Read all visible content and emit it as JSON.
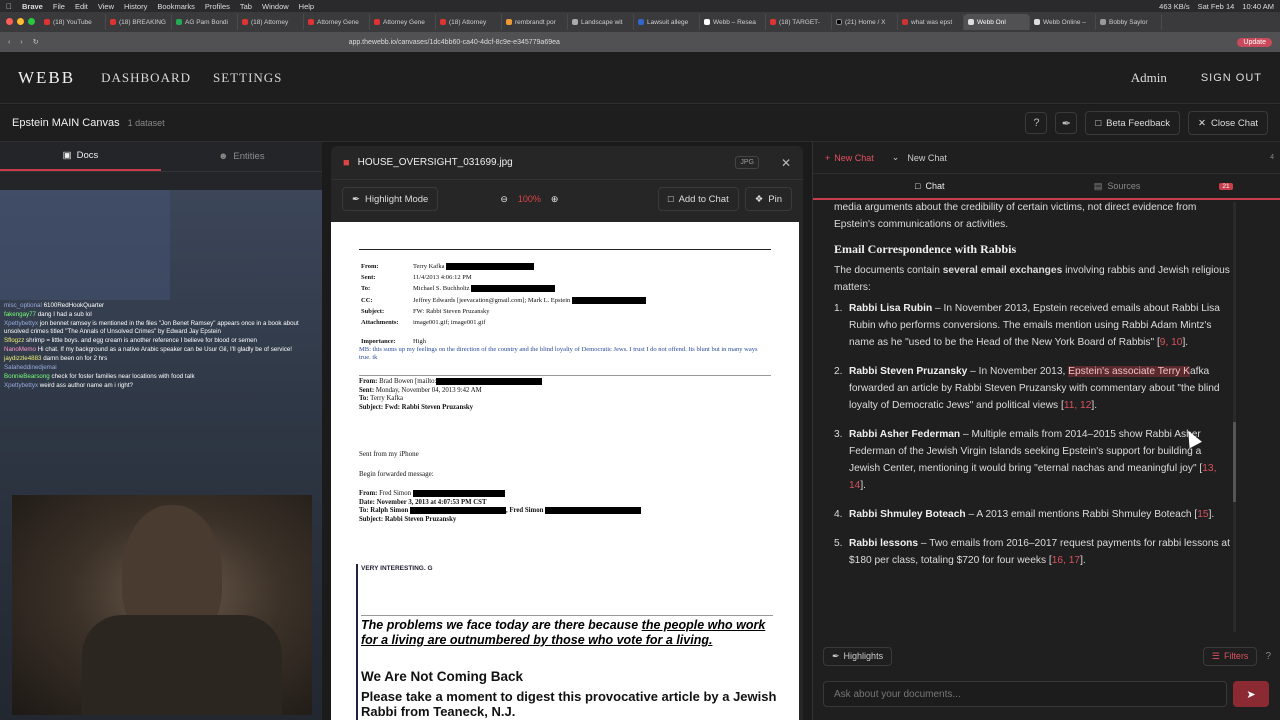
{
  "mac_menu": {
    "apple": "",
    "app": "Brave",
    "items": [
      "File",
      "Edit",
      "View",
      "History",
      "Bookmarks",
      "Profiles",
      "Tab",
      "Window",
      "Help"
    ],
    "status": [
      "463 KB/s",
      "Sat Feb 14",
      "10:40 AM"
    ]
  },
  "browser": {
    "tabs": [
      "(18) YouTube",
      "(18) BREAKING",
      "AG Pam Bondi",
      "(18) Attorney",
      "Attorney Gene",
      "Attorney Gene",
      "(18) Attorney",
      "rembrandt por",
      "Landscape wit",
      "Lawsuit allege",
      "Webb – Resea",
      "(18) TARGET-",
      "(21) Home / X",
      "what was epst",
      "Webb Onl",
      "Webb Online –",
      "Bobby Saylor"
    ],
    "active_tab_index": 14,
    "url": "app.thewebb.io/canvases/1dc4bb60-ca40-4dcf-8c9e-e345779a69ea",
    "update_label": "Update"
  },
  "nav": {
    "logo": "WEBB",
    "links": [
      "DASHBOARD",
      "SETTINGS"
    ],
    "admin": "Admin",
    "signout": "SIGN OUT"
  },
  "canvas": {
    "title": "Epstein MAIN Canvas",
    "datasets": "1 dataset",
    "beta_feedback": "Beta Feedback",
    "close_chat": "Close Chat"
  },
  "left": {
    "tabs": [
      "Docs",
      "Entities"
    ],
    "stream_chat": [
      {
        "user": "misc_optional",
        "text": "6100RedHookQuarter"
      },
      {
        "user": "fakengay77",
        "text": "dang I had a sub lol"
      },
      {
        "user": "Xpettybettyx",
        "text": "jon bennet ramsey is mentioned in the files \"Jon Benet Ramsey\" appears once in a book about unsolved crimes titled \"The Annals of Unsolved Crimes\" by Edward Jay Epstein"
      },
      {
        "user": "Sflogzz",
        "text": "shrimp = little boys. and egg cream is another reference I believe for blood or semen"
      },
      {
        "user": "NanoMemo",
        "text": "Hi chat. If my background as a native Arabic speaker can be Usur Gil, I'll gladly be of service!"
      },
      {
        "user": "jaydizzle4883",
        "text": "damn been on for 2 hrs"
      },
      {
        "user": "Salaheddinedjemai",
        "text": ""
      },
      {
        "user": "BonnieBearsong",
        "text": "check for foster families near locations with food talk"
      },
      {
        "user": "Xpettybettyx",
        "text": "weird ass author name am i right?"
      }
    ]
  },
  "doc": {
    "filename": "HOUSE_OVERSIGHT_031699.jpg",
    "type_badge": "JPG",
    "highlight_mode": "Highlight Mode",
    "zoom": "100%",
    "add_to_chat": "Add to Chat",
    "pin": "Pin",
    "email_header": [
      {
        "k": "From:",
        "v": "Terry Kafka"
      },
      {
        "k": "Sent:",
        "v": "11/4/2013 4:06:12 PM"
      },
      {
        "k": "To:",
        "v": "Michael S. Buchholtz"
      },
      {
        "k": "CC:",
        "v": "Jeffrey Edwards [jeevacation@gmail.com]; Mark L. Epstein"
      },
      {
        "k": "Subject:",
        "v": "FW: Rabbi Steven Pruzansky"
      },
      {
        "k": "Attachments:",
        "v": "image001.gif; image001.gif"
      },
      {
        "k": "Importance:",
        "v": "High"
      }
    ],
    "mb_note": "MB: this sums up my feelings on the direction of the country and the blind loyalty of Democratic Jews.  I trust I do not offend.  Its blunt but in many ways true.  tk",
    "fwd1": {
      "from": "Brad Bowen [mailto:",
      "sent": "Monday, November 04, 2013 9:42 AM",
      "to": "Terry Kafka",
      "subject": "Fwd: Rabbi Steven Pruzansky"
    },
    "sent_from": "Sent from my iPhone",
    "begin_fwd": "Begin forwarded message:",
    "fwd2": {
      "from": "Fred Simon",
      "date": "November 3, 2013 at 4:07:53 PM CST",
      "to": "Ralph Simon",
      "to_extra": ", Fred Simon",
      "subject": "Rabbi Steven Pruzansky"
    },
    "very_interesting": "VERY INTERESTING.   G",
    "quote_pre": "The problems we face today are there because ",
    "quote_u": "the people who work for a living are outnumbered by those who vote for a living.",
    "h_not_coming": "We Are Not Coming Back",
    "h_please": "Please take a moment to digest this provocative article by a Jewish Rabbi from Teaneck, N.J."
  },
  "chat": {
    "new_chat_btn": "New Chat",
    "chat_select": "New Chat",
    "count": "4",
    "tabs": [
      "Chat",
      "Sources"
    ],
    "sources_badge": "21",
    "intro_tail": "media arguments about the credibility of certain victims, not direct evidence from Epstein's communications or activities.",
    "heading": "Email Correspondence with Rabbis",
    "lead_pre": "The documents contain ",
    "lead_bold": "several email exchanges",
    "lead_post": " involving rabbis and Jewish religious matters:",
    "items": [
      {
        "num": "1.",
        "name": "Rabbi Lisa Rubin",
        "text": " – In November 2013, Epstein received emails about Rabbi Lisa Rubin who performs conversions. The emails mention using Rabbi Adam Mintz's name as he \"used to be the Head of the New York Board of Rabbis\" [",
        "cites": "9, 10",
        "end": "]."
      },
      {
        "num": "2.",
        "name": "Rabbi Steven Pruzansky",
        "text": " – In November 2013, ",
        "highlight": "Epstein's associate Terry K",
        "text2": "afka forwarded an article by Rabbi Steven Pruzansky with commentary about \"the blind loyalty of Democratic Jews\" and political views [",
        "cites": "11, 12",
        "end": "]."
      },
      {
        "num": "3.",
        "name": "Rabbi Asher Federman",
        "text": " – Multiple emails from 2014–2015 show Rabbi Asher Federman of the Jewish Virgin Islands seeking Epstein's support for building a Jewish Center, mentioning it would bring \"eternal nachas and meaningful joy\" [",
        "cites": "13, 14",
        "end": "]."
      },
      {
        "num": "4.",
        "name": "Rabbi Shmuley Boteach",
        "text": " – A 2013 email mentions Rabbi Shmuley Boteach [",
        "cites": "15",
        "end": "]."
      },
      {
        "num": "5.",
        "name": "Rabbi lessons",
        "text": " – Two emails from 2016–2017 request payments for rabbi lessons at $180 per class, totaling $720 for four weeks [",
        "cites": "16, 17",
        "end": "]."
      }
    ],
    "highlights_btn": "Highlights",
    "filters_btn": "Filters",
    "ask_placeholder": "Ask about your documents..."
  },
  "colors": {
    "accent": "#c73d4b",
    "cite": "#d9525e"
  }
}
